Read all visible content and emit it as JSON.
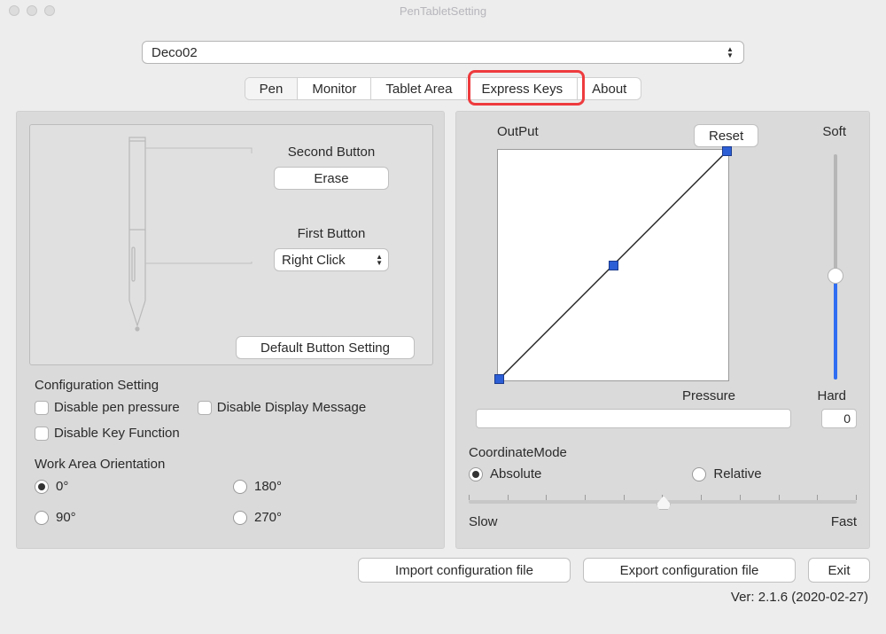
{
  "window": {
    "title": "PenTabletSetting"
  },
  "device": {
    "selected": "Deco02"
  },
  "tabs": {
    "pen": "Pen",
    "monitor": "Monitor",
    "tablet_area": "Tablet Area",
    "express_keys": "Express Keys",
    "about": "About"
  },
  "pen_panel": {
    "second_label": "Second Button",
    "second_value": "Erase",
    "first_label": "First Button",
    "first_value": "Right Click",
    "default_btn": "Default  Button Setting"
  },
  "config": {
    "title": "Configuration Setting",
    "disable_pressure": "Disable pen pressure",
    "disable_display": "Disable Display Message",
    "disable_keys": "Disable Key Function"
  },
  "orientation": {
    "title": "Work Area Orientation",
    "o0": "0°",
    "o180": "180°",
    "o90": "90°",
    "o270": "270°"
  },
  "pressure": {
    "output": "OutPut",
    "reset": "Reset",
    "soft": "Soft",
    "hard": "Hard",
    "label": "Pressure",
    "value": "0"
  },
  "coord": {
    "title": "CoordinateMode",
    "absolute": "Absolute",
    "relative": "Relative",
    "slow": "Slow",
    "fast": "Fast"
  },
  "footer": {
    "import": "Import configuration file",
    "export": "Export configuration file",
    "exit": "Exit"
  },
  "version": "Ver: 2.1.6 (2020-02-27)"
}
